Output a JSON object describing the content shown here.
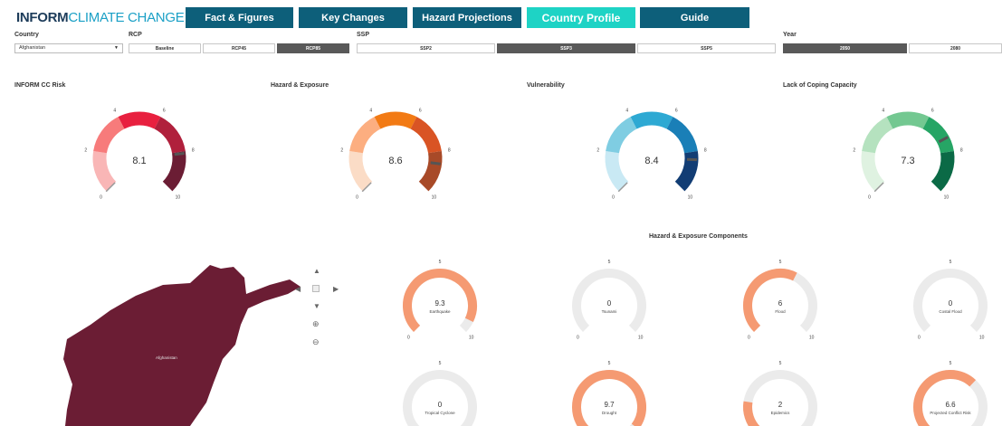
{
  "header": {
    "logo_bold": "INFORM",
    "logo_light": "CLIMATE CHANGE",
    "nav": [
      {
        "label": "Fact & Figures",
        "active": false
      },
      {
        "label": "Key Changes",
        "active": false
      },
      {
        "label": "Hazard Projections",
        "active": false
      },
      {
        "label": "Country Profile",
        "active": true
      },
      {
        "label": "Guide",
        "active": false
      }
    ]
  },
  "filters": {
    "country_label": "Country",
    "country_value": "Afghanistan",
    "rcp_label": "RCP",
    "rcp_options": [
      "Baseline",
      "RCP45",
      "RCP85"
    ],
    "rcp_selected": "RCP85",
    "ssp_label": "SSP",
    "ssp_options": [
      "SSP2",
      "SSP3",
      "SSP5"
    ],
    "ssp_selected": "SSP3",
    "year_label": "Year",
    "year_options": [
      "2050",
      "2080"
    ],
    "year_selected": "2050"
  },
  "gauges": [
    {
      "title": "INFORM CC Risk",
      "value": 8.1,
      "display": "8.1",
      "colors": [
        "#f9b6b6",
        "#f77b7b",
        "#e8203f",
        "#b0203c",
        "#6b1d34"
      ]
    },
    {
      "title": "Hazard & Exposure",
      "value": 8.6,
      "display": "8.6",
      "colors": [
        "#fbdcc6",
        "#fcae80",
        "#f27a14",
        "#d95424",
        "#a84a28"
      ]
    },
    {
      "title": "Vulnerability",
      "value": 8.4,
      "display": "8.4",
      "colors": [
        "#c9e9f4",
        "#7fcde2",
        "#2ea9d3",
        "#1a7fb7",
        "#123d74"
      ]
    },
    {
      "title": "Lack of Coping Capacity",
      "value": 7.3,
      "display": "7.3",
      "colors": [
        "#dff2e1",
        "#b5e2bf",
        "#73c891",
        "#26a565",
        "#0b6a46"
      ]
    }
  ],
  "gauge_ticks": [
    "0",
    "2",
    "4",
    "6",
    "8",
    "10"
  ],
  "components": {
    "title": "Hazard & Exposure Components",
    "fill_color": "#f59a72",
    "track_color": "#ebebeb",
    "tick_min": "0",
    "tick_mid": "5",
    "tick_max": "10",
    "items": [
      {
        "label": "Earthquake",
        "value": 9.3,
        "display": "9.3"
      },
      {
        "label": "Tsunami",
        "value": 0,
        "display": "0"
      },
      {
        "label": "Flood",
        "value": 6,
        "display": "6"
      },
      {
        "label": "Costal Flood",
        "value": 0,
        "display": "0"
      },
      {
        "label": "Tropical Cyclone",
        "value": 0,
        "display": "0"
      },
      {
        "label": "Drought",
        "value": 9.7,
        "display": "9.7"
      },
      {
        "label": "Epidemics",
        "value": 2,
        "display": "2"
      },
      {
        "label": "Projected Conflict Risk",
        "value": 6.6,
        "display": "6.6"
      }
    ]
  },
  "map": {
    "country_label": "Afghanistan",
    "fill_color": "#6b1d34",
    "controls": [
      "pan-up",
      "pan-left",
      "reset",
      "pan-right",
      "pan-down",
      "zoom-in",
      "zoom-out"
    ]
  }
}
